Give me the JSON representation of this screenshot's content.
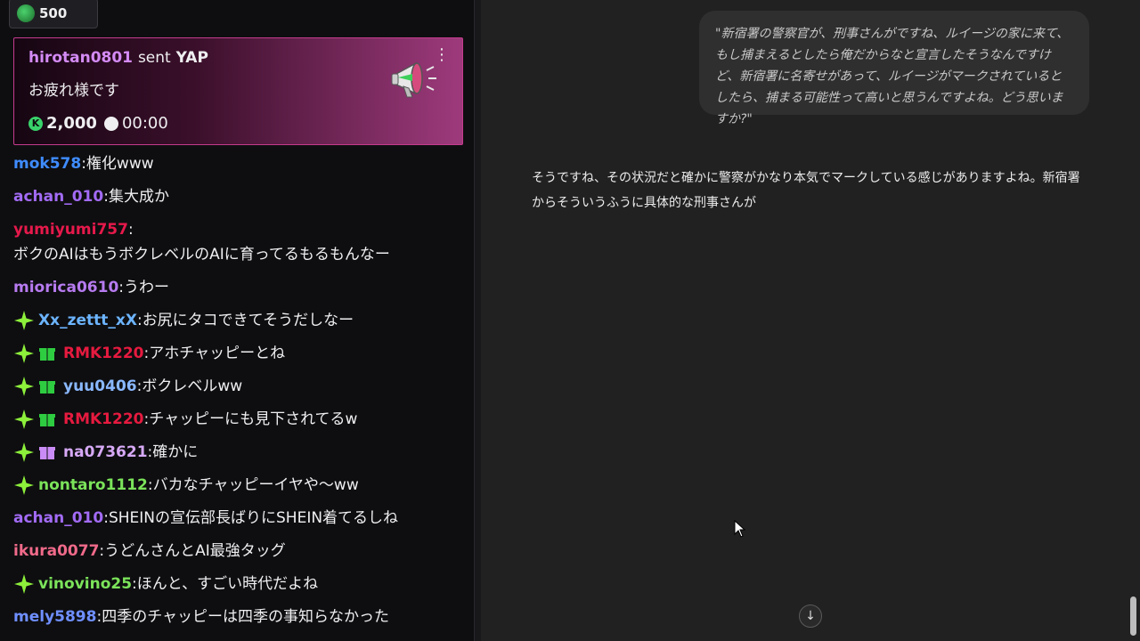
{
  "top_badge": {
    "count": "500"
  },
  "yap_card": {
    "username": "hirotan0801",
    "sent_text": "sent",
    "item": "YAP",
    "message": "お疲れ様です",
    "coin_glyph": "K",
    "amount": "2,000",
    "time": "00:00",
    "menu_glyph": "⋮"
  },
  "chat_messages": [
    {
      "user": "mok578",
      "color": "#3f8cff",
      "text": "権化www",
      "spark": false,
      "gift": null
    },
    {
      "user": "achan_010",
      "color": "#a26bf5",
      "text": "集大成か",
      "spark": false,
      "gift": null
    },
    {
      "user": "yumiyumi757",
      "color": "#e6194b",
      "text": "ボクのAIはもうボクレベルのAIに育ってるもるもんなー",
      "spark": false,
      "gift": null
    },
    {
      "user": "miorica0610",
      "color": "#b77bf0",
      "text": "うわー",
      "spark": false,
      "gift": null
    },
    {
      "user": "Xx_zettt_xX",
      "color": "#6cb4ff",
      "text": "お尻にタコできてそうだしなー",
      "spark": true,
      "gift": null
    },
    {
      "user": "RMK1220",
      "color": "#e61a3f",
      "text": "アホチャッピーとね",
      "spark": true,
      "gift": "#2ecc40"
    },
    {
      "user": "yuu0406",
      "color": "#8ab8ff",
      "text": "ボクレベルww",
      "spark": true,
      "gift": "#2ecc40"
    },
    {
      "user": "RMK1220",
      "color": "#e61a3f",
      "text": "チャッピーにも見下されてるw",
      "spark": true,
      "gift": "#2ecc40"
    },
    {
      "user": "na073621",
      "color": "#d6a9f5",
      "text": "確かに",
      "spark": true,
      "gift": "#c98bf5"
    },
    {
      "user": "nontaro1112",
      "color": "#7be35a",
      "text": "バカなチャッピーイヤや〜ww",
      "spark": true,
      "gift": null
    },
    {
      "user": "achan_010",
      "color": "#a26bf5",
      "text": "SHEINの宣伝部長ばりにSHEIN着てるしね",
      "spark": false,
      "gift": null
    },
    {
      "user": "ikura0077",
      "color": "#f06a8a",
      "text": "うどんさんとAI最強タッグ",
      "spark": false,
      "gift": null
    },
    {
      "user": "vinovino25",
      "color": "#7be35a",
      "text": "ほんと、すごい時代だよね",
      "spark": true,
      "gift": null
    },
    {
      "user": "mely5898",
      "color": "#6f8fff",
      "text": "四季のチャッピーは四季の事知らなかった",
      "spark": false,
      "gift": null
    }
  ],
  "assistant": {
    "user_prompt": "\"新宿署の警察官が、刑事さんがですね、ルイージの家に来て、もし捕まえるとしたら俺だからなと宣言したそうなんですけど、新宿署に名寄せがあって、ルイージがマークされているとしたら、捕まる可能性って高いと思うんですよね。どう思いますか?\"",
    "reply": "そうですね、その状況だと確かに警察がかなり本気でマークしている感じがありますよね。新宿署からそういうふうに具体的な刑事さんが",
    "scroll_glyph": "↓"
  },
  "colors": {
    "chat_bg": "#0e0e10",
    "main_bg": "#212121",
    "bubble_bg": "#2f2f2f",
    "yap_border": "#c43b8d"
  },
  "icons": [
    "gem-icon",
    "megaphone-icon",
    "coin-icon",
    "clock-icon",
    "sparkle-icon",
    "gift-icon",
    "cursor-icon",
    "arrow-down-icon"
  ]
}
